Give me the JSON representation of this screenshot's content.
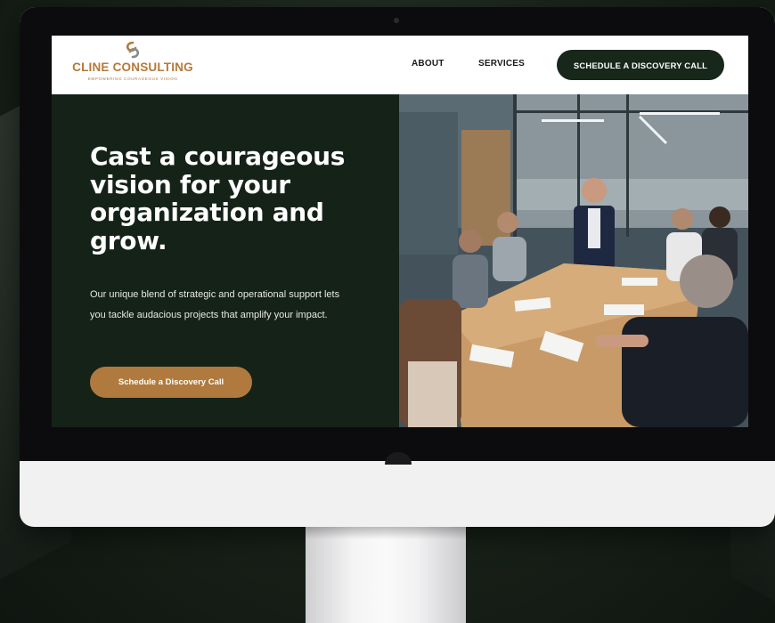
{
  "brand": {
    "name": "CLINE CONSULTING",
    "tagline": "EMPOWERING COURAGEOUS VISION",
    "accent": "#b5793a",
    "dark_green": "#152218"
  },
  "nav": {
    "about": "ABOUT",
    "services": "SERVICES",
    "cta": "SCHEDULE A DISCOVERY CALL"
  },
  "hero": {
    "title": "Cast a courageous vision for your organization and grow.",
    "body": "Our unique blend of strategic and operational support lets you tackle audacious projects that amplify your impact.",
    "cta": "Schedule a Discovery Call",
    "image": "photo of a team meeting around a wooden conference table"
  },
  "icons": {
    "logo": "interlocking-rings-logo-icon"
  }
}
